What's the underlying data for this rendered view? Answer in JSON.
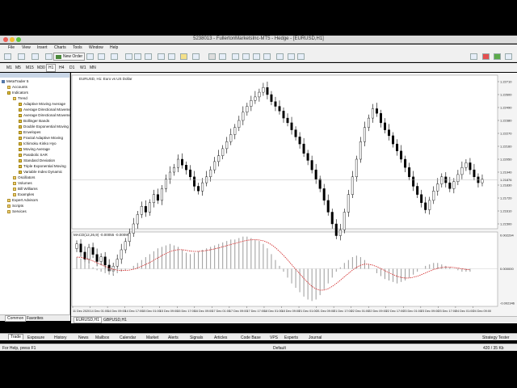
{
  "window": {
    "title": "5238013 - FullertonMarketsInc-MT5 - Hedge - [EURUSD,H1]"
  },
  "menu": [
    "File",
    "View",
    "Insert",
    "Charts",
    "Tools",
    "Window",
    "Help"
  ],
  "toolbar": {
    "new_order_label": "New Order"
  },
  "timeframes": [
    "M1",
    "M5",
    "M15",
    "M30",
    "H1",
    "H4",
    "D1",
    "W1",
    "MN"
  ],
  "timeframe_selected": "H1",
  "navigator": {
    "root": "MetaTrader 5",
    "items": [
      {
        "label": "Accounts",
        "level": 1,
        "icon": "folder"
      },
      {
        "label": "Indicators",
        "level": 1,
        "icon": "indicator"
      },
      {
        "label": "Trend",
        "level": 2,
        "icon": "folder"
      },
      {
        "label": "Adaptive Moving Average",
        "level": 3,
        "icon": "indicator"
      },
      {
        "label": "Average Directional Movement",
        "level": 3,
        "icon": "indicator"
      },
      {
        "label": "Average Directional Movement",
        "level": 3,
        "icon": "indicator"
      },
      {
        "label": "Bollinger Bands",
        "level": 3,
        "icon": "indicator"
      },
      {
        "label": "Double Exponential Moving",
        "level": 3,
        "icon": "indicator"
      },
      {
        "label": "Envelopes",
        "level": 3,
        "icon": "indicator"
      },
      {
        "label": "Fractal Adaptive Moving",
        "level": 3,
        "icon": "indicator"
      },
      {
        "label": "Ichimoku Kinko Hyo",
        "level": 3,
        "icon": "indicator"
      },
      {
        "label": "Moving Average",
        "level": 3,
        "icon": "indicator"
      },
      {
        "label": "Parabolic SAR",
        "level": 3,
        "icon": "indicator"
      },
      {
        "label": "Standard Deviation",
        "level": 3,
        "icon": "indicator"
      },
      {
        "label": "Triple Exponential Moving",
        "level": 3,
        "icon": "indicator"
      },
      {
        "label": "Variable Index Dynamic",
        "level": 3,
        "icon": "indicator"
      },
      {
        "label": "Oscillators",
        "level": 2,
        "icon": "folder"
      },
      {
        "label": "Volumes",
        "level": 2,
        "icon": "folder"
      },
      {
        "label": "Bill Williams",
        "level": 2,
        "icon": "folder"
      },
      {
        "label": "Examples",
        "level": 2,
        "icon": "folder"
      },
      {
        "label": "Expert Advisors",
        "level": 1,
        "icon": "folder"
      },
      {
        "label": "Scripts",
        "level": 1,
        "icon": "folder"
      },
      {
        "label": "Services",
        "level": 1,
        "icon": "folder"
      }
    ],
    "tabs": [
      "Common",
      "Favorites"
    ]
  },
  "chart": {
    "header": "EURUSD, H1:  Euro vs US Dollar",
    "indicator_header": "MACD(12,26,9) -0.00055 -0.00099",
    "price_ticks": [
      "1.22710",
      "1.22600",
      "1.22490",
      "1.22380",
      "1.22270",
      "1.22160",
      "1.22050",
      "1.21940",
      "1.21830",
      "1.21720",
      "1.21610",
      "1.21500"
    ],
    "current_price": "1.21876",
    "macd_ticks": [
      "0.002294",
      "0.000000",
      "-0.002346"
    ],
    "time_labels": [
      "11 Dec 2020",
      "14 Dec 01:00",
      "14 Dec 09:00",
      "14 Dec 17:00",
      "15 Dec 01:00",
      "15 Dec 09:00",
      "15 Dec 17:00",
      "16 Dec 09:00",
      "17 Dec 01:00",
      "17 Dec 09:00",
      "17 Dec 17:00",
      "18 Dec 01:00",
      "18 Dec 09:00",
      "21 Dec 01:00",
      "21 Dec 09:00",
      "21 Dec 17:00",
      "22 Dec 01:00",
      "22 Dec 09:00",
      "22 Dec 17:00",
      "23 Dec 01:00",
      "23 Dec 09:00",
      "23 Dec 17:00",
      "24 Dec 01:00",
      "24 Dec 09:00"
    ],
    "tabs": [
      "EURUSD,H1",
      "GBPUSD,H1"
    ]
  },
  "chart_data": {
    "type": "candlestick",
    "closes": [
      1.2133,
      1.2126,
      1.212,
      1.213,
      1.2124,
      1.2118,
      1.2122,
      1.2115,
      1.211,
      1.2114,
      1.212,
      1.2128,
      1.2135,
      1.2142,
      1.215,
      1.2158,
      1.2165,
      1.216,
      1.2168,
      1.2175,
      1.217,
      1.218,
      1.2188,
      1.2194,
      1.2198,
      1.2205,
      1.22,
      1.2196,
      1.219,
      1.2182,
      1.2178,
      1.2185,
      1.219,
      1.2196,
      1.2203,
      1.2208,
      1.2214,
      1.222,
      1.2226,
      1.2232,
      1.2238,
      1.2245,
      1.225,
      1.2255,
      1.2258,
      1.2262,
      1.2266,
      1.226,
      1.2254,
      1.225,
      1.2246,
      1.224,
      1.2236,
      1.223,
      1.2224,
      1.2218,
      1.221,
      1.2204,
      1.2196,
      1.2188,
      1.218,
      1.217,
      1.216,
      1.215,
      1.214,
      1.2145,
      1.216,
      1.2175,
      1.219,
      1.2205,
      1.222,
      1.2232,
      1.224,
      1.2248,
      1.2244,
      1.2236,
      1.223,
      1.2225,
      1.2218,
      1.2212,
      1.2205,
      1.2198,
      1.219,
      1.2182,
      1.2175,
      1.2168,
      1.2162,
      1.217,
      1.2178,
      1.2184,
      1.219,
      1.2185,
      1.218,
      1.2186,
      1.2192,
      1.2198,
      1.2202,
      1.2196,
      1.219,
      1.2185,
      1.2188
    ],
    "macd_histogram": [
      0.0008,
      0.0007,
      0.0005,
      0.0003,
      0.0001,
      -0.0001,
      -0.0002,
      -0.0003,
      -0.0004,
      -0.0004,
      -0.0003,
      -0.0002,
      -0.0001,
      0.0,
      0.0002,
      0.0004,
      0.0006,
      0.0008,
      0.001,
      0.0012,
      0.0014,
      0.0015,
      0.0016,
      0.0017,
      0.0016,
      0.0015,
      0.0013,
      0.0011,
      0.001,
      0.0011,
      0.0012,
      0.0013,
      0.0014,
      0.0015,
      0.0016,
      0.0017,
      0.0018,
      0.0019,
      0.002,
      0.002,
      0.0021,
      0.0022,
      0.0022,
      0.0021,
      0.002,
      0.0019,
      0.0017,
      0.0014,
      0.001,
      0.0006,
      0.0002,
      -0.0002,
      -0.0006,
      -0.001,
      -0.0013,
      -0.0016,
      -0.0019,
      -0.0021,
      -0.0022,
      -0.0021,
      -0.0018,
      -0.0014,
      -0.001,
      -0.0006,
      -0.0002,
      0.0001,
      0.0004,
      0.0006,
      0.0008,
      0.0009,
      0.0008,
      0.0006,
      0.0003,
      0.0,
      -0.0003,
      -0.0005,
      -0.0007,
      -0.0008,
      -0.0009,
      -0.001,
      -0.0009,
      -0.0008,
      -0.0006,
      -0.0004,
      -0.0002,
      0.0,
      0.0002,
      0.0003,
      0.0004,
      0.0004,
      0.0003,
      0.0002,
      0.0001,
      0.0,
      -0.0001,
      -0.0002,
      -0.0002,
      -0.0002
    ],
    "price_range": [
      1.215,
      1.2271
    ],
    "macd_range": [
      -0.002346,
      0.002294
    ],
    "colors": {
      "candle": "#000000",
      "signal": "#d02020",
      "histogram": "#9a9a9a",
      "current_line": "#bbbbbb"
    }
  },
  "toolbox_tabs": [
    "Trade",
    "Exposure",
    "History",
    "News",
    "Mailbox",
    "Calendar",
    "Market",
    "Alerts",
    "Signals",
    "Articles",
    "Code Base",
    "VPS",
    "Experts",
    "Journal"
  ],
  "toolbox_active": "Trade",
  "toolbox_right": "Strategy Tester",
  "status": {
    "help": "For Help, press F1",
    "profile": "Default",
    "traffic": "420 / 35 Kb"
  }
}
